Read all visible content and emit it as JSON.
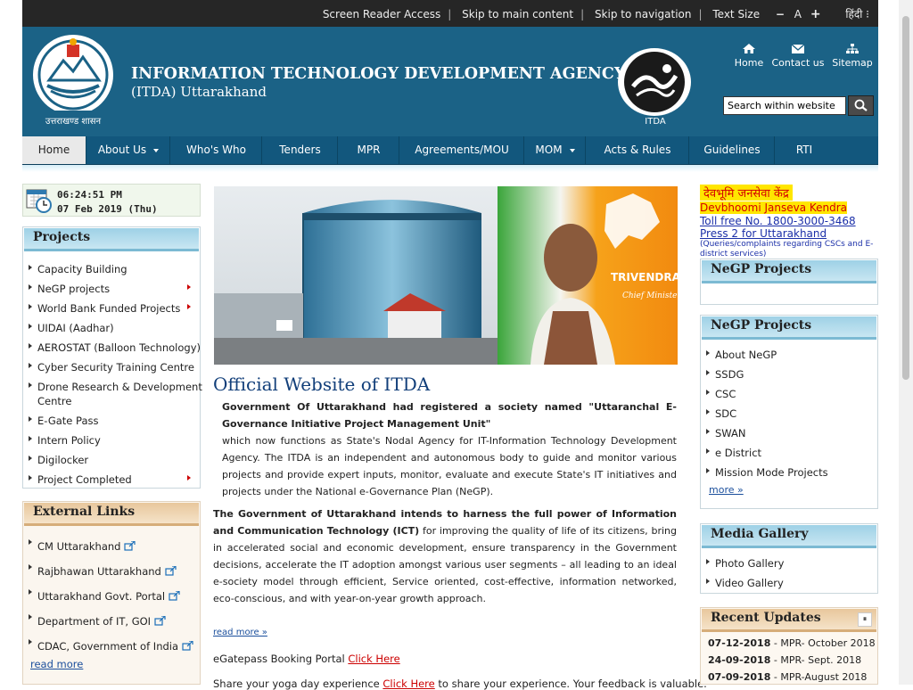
{
  "topbar": {
    "screen_reader": "Screen Reader Access",
    "skip_main": "Skip to main content",
    "skip_nav": "Skip to navigation",
    "text_size": "Text Size",
    "size_minus": "−",
    "size_normal": "A",
    "size_plus": "+",
    "language": "हिंदी ⁝"
  },
  "header": {
    "title": "INFORMATION TECHNOLOGY DEVELOPMENT AGENCY",
    "subtitle": "(ITDA) Uttarakhand",
    "state_logo_text": "उत्तराखण्ड शासन",
    "itda_label": "ITDA",
    "home": "Home",
    "contact": "Contact us",
    "sitemap": "Sitemap",
    "search_placeholder": "Search within website"
  },
  "nav": {
    "items": [
      "Home",
      "About Us",
      "Who's Who",
      "Tenders",
      "MPR",
      "Agreements/MOU",
      "MOM",
      "Acts & Rules",
      "Guidelines",
      "RTI"
    ]
  },
  "clock": {
    "time": "06:24:51 PM",
    "date": "07 Feb 2019 (Thu)"
  },
  "projects": {
    "title": "Projects",
    "items": [
      "Capacity Building",
      "NeGP projects",
      "World Bank Funded Projects",
      "UIDAI (Aadhar)",
      "AEROSTAT (Balloon Technology)",
      "Cyber Security Training Centre",
      "Drone Research & Development",
      "Centre",
      "E-Gate Pass",
      "Intern Policy",
      "Digilocker",
      "Project Completed"
    ]
  },
  "external": {
    "title": "External Links",
    "items": [
      "CM Uttarakhand",
      "Rajbhawan Uttarakhand",
      "Uttarakhand Govt. Portal",
      "Department of IT, GOI",
      "CDAC, Government of India"
    ],
    "read_more": "read more"
  },
  "banner": {
    "name": "TRIVENDRA SINGH RAWAT",
    "role": "Chief Minister of Uttarakhand"
  },
  "main": {
    "title": "Official Website of ITDA",
    "p1_bold": "Government Of Uttarakhand had registered a society named \"Uttaranchal E-Governance Initiative Project Management Unit\"",
    "p1": "which now functions as State's Nodal Agency for IT-Information Technology Development Agency. The ITDA is an independent and autonomous body to guide and monitor various projects and provide expert inputs, monitor, evaluate and execute State's IT initiatives and projects under the National e-Governance Plan (NeGP).",
    "p2_bold": "The Government of Uttarakhand intends to harness the full power of Information and Communication Technology (ICT)",
    "p2": " for improving the quality of life of its citizens, bring in accelerated social and economic development, ensure transparency in the Government decisions, accelerate the IT adoption amongst various user segments – all leading to an ideal e-society model through efficient, Service oriented, cost-effective, information networked, eco-conscious, and with year-on-year growth approach.",
    "read_more": "read more »",
    "egate_text": "eGatepass Booking Portal ",
    "egate_link": "Click Here",
    "yoga_text": "Share your yoga day experience ",
    "yoga_link": "Click Here",
    "yoga_tail": " to share your experience. Your feedback is valuable."
  },
  "janseva": {
    "hindi": "देवभूमि जनसेवा केंद्र",
    "name": "Devbhoomi Janseva Kendra",
    "tollfree": "Toll free No. 1800-3000-3468",
    "press": "Press 2 for Uttarakhand ",
    "note": "(Queries/complaints regarding CSCs and E-district services)"
  },
  "negp1": {
    "title": "NeGP Projects"
  },
  "negp2": {
    "title": "NeGP Projects",
    "items": [
      "About NeGP",
      "SSDG",
      "CSC",
      "SDC",
      "SWAN",
      "e District",
      "Mission Mode Projects"
    ],
    "more": "more »"
  },
  "media": {
    "title": "Media Gallery",
    "items": [
      "Photo Gallery",
      "Video Gallery"
    ]
  },
  "updates": {
    "title": "Recent Updates",
    "pause": "⏸",
    "items": [
      {
        "date": "07-12-2018",
        "text": " - MPR- October 2018"
      },
      {
        "date": "24-09-2018",
        "text": " - MPR- Sept. 2018"
      },
      {
        "date": "07-09-2018",
        "text": " - MPR-August 2018"
      }
    ]
  }
}
